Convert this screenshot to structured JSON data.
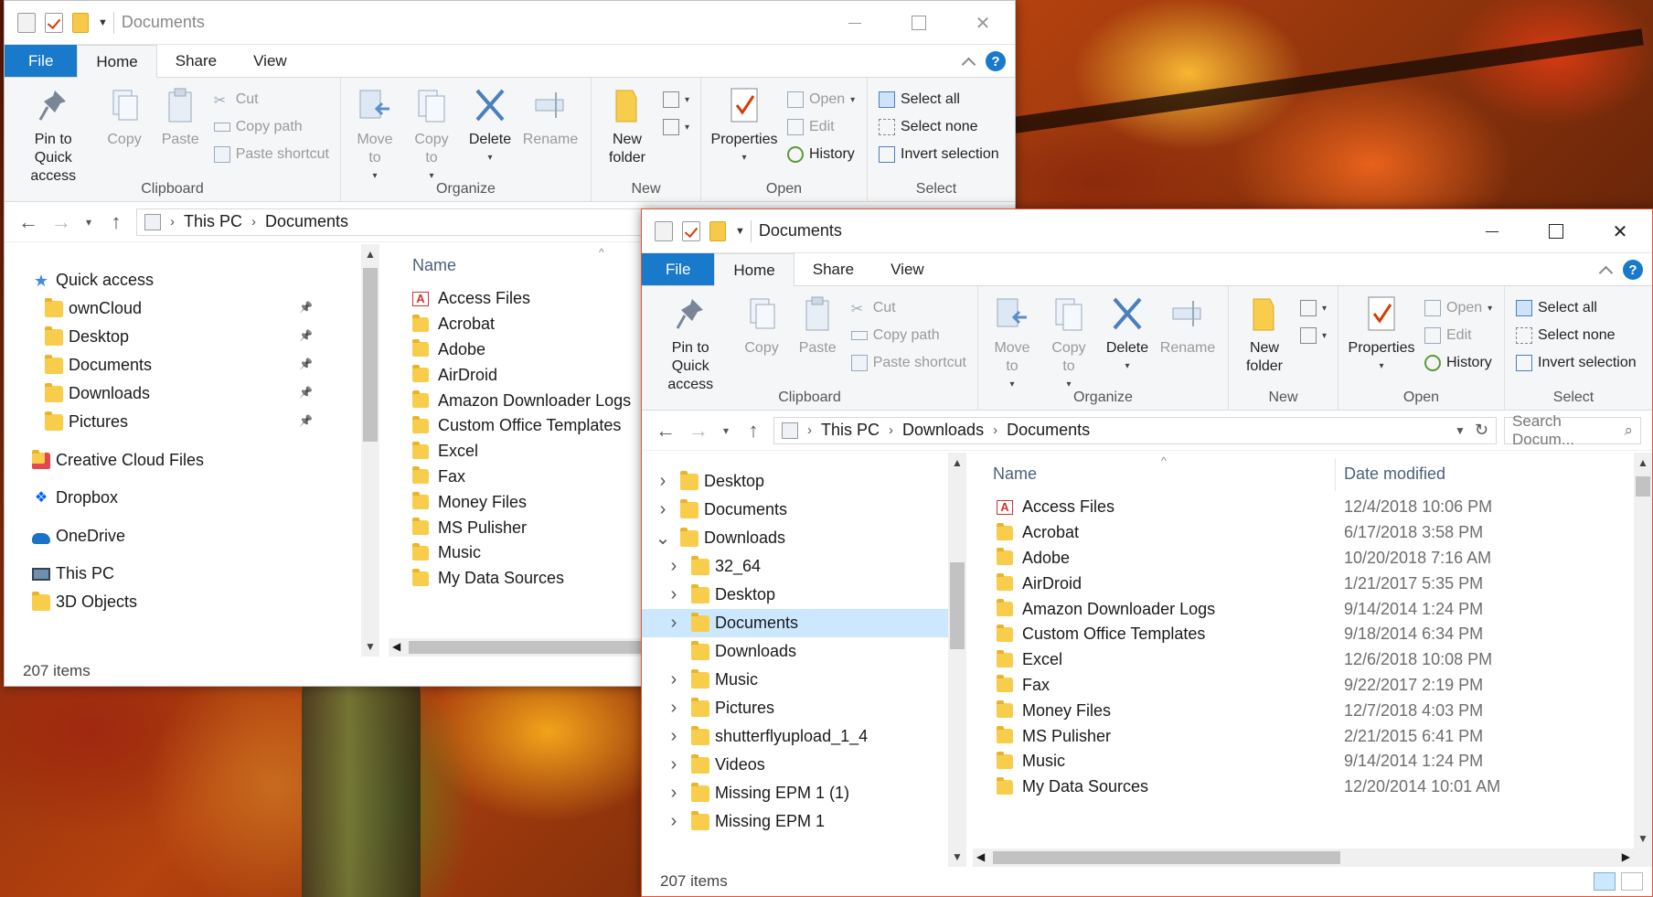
{
  "windows": [
    {
      "title": "Documents",
      "tabs": {
        "file": "File",
        "home": "Home",
        "share": "Share",
        "view": "View"
      },
      "ribbon": {
        "clipboard": {
          "label": "Clipboard",
          "pin": "Pin to Quick access",
          "copy": "Copy",
          "paste": "Paste",
          "cut": "Cut",
          "copy_path": "Copy path",
          "paste_shortcut": "Paste shortcut"
        },
        "organize": {
          "label": "Organize",
          "move_to": "Move to",
          "copy_to": "Copy to",
          "delete": "Delete",
          "rename": "Rename"
        },
        "new": {
          "label": "New",
          "new_folder": "New folder"
        },
        "open": {
          "label": "Open",
          "properties": "Properties",
          "open": "Open",
          "edit": "Edit",
          "history": "History"
        },
        "select": {
          "label": "Select",
          "select_all": "Select all",
          "select_none": "Select none",
          "invert": "Invert selection"
        }
      },
      "address": [
        "This PC",
        "Documents"
      ],
      "nav": [
        {
          "label": "Quick access",
          "icon": "star-icon"
        },
        {
          "label": "ownCloud",
          "icon": "folder-icon",
          "pinned": true
        },
        {
          "label": "Desktop",
          "icon": "desktop-folder-icon",
          "pinned": true
        },
        {
          "label": "Documents",
          "icon": "documents-folder-icon",
          "pinned": true
        },
        {
          "label": "Downloads",
          "icon": "downloads-folder-icon",
          "pinned": true
        },
        {
          "label": "Pictures",
          "icon": "pictures-folder-icon",
          "pinned": true
        },
        {
          "label": "Creative Cloud Files",
          "icon": "creative-cloud-icon"
        },
        {
          "label": "Dropbox",
          "icon": "dropbox-icon"
        },
        {
          "label": "OneDrive",
          "icon": "onedrive-icon"
        },
        {
          "label": "This PC",
          "icon": "computer-icon"
        },
        {
          "label": "3D Objects",
          "icon": "3d-objects-icon"
        }
      ],
      "column_name": "Name",
      "files": [
        "Access Files",
        "Acrobat",
        "Adobe",
        "AirDroid",
        "Amazon Downloader Logs",
        "Custom Office Templates",
        "Excel",
        "Fax",
        "Money Files",
        "MS Pulisher",
        "Music",
        "My Data Sources"
      ],
      "status": "207 items"
    },
    {
      "title": "Documents",
      "tabs": {
        "file": "File",
        "home": "Home",
        "share": "Share",
        "view": "View"
      },
      "ribbon": {
        "clipboard": {
          "label": "Clipboard",
          "pin": "Pin to Quick access",
          "copy": "Copy",
          "paste": "Paste",
          "cut": "Cut",
          "copy_path": "Copy path",
          "paste_shortcut": "Paste shortcut"
        },
        "organize": {
          "label": "Organize",
          "move_to": "Move to",
          "copy_to": "Copy to",
          "delete": "Delete",
          "rename": "Rename"
        },
        "new": {
          "label": "New",
          "new_folder": "New folder"
        },
        "open": {
          "label": "Open",
          "properties": "Properties",
          "open": "Open",
          "edit": "Edit",
          "history": "History"
        },
        "select": {
          "label": "Select",
          "select_all": "Select all",
          "select_none": "Select none",
          "invert": "Invert selection"
        }
      },
      "address": [
        "This PC",
        "Downloads",
        "Documents"
      ],
      "search_placeholder": "Search Docum...",
      "nav": [
        {
          "label": "Desktop",
          "level": 0,
          "expanded": false
        },
        {
          "label": "Documents",
          "level": 0,
          "expanded": false
        },
        {
          "label": "Downloads",
          "level": 0,
          "expanded": true
        },
        {
          "label": "32_64",
          "level": 1,
          "expanded": false
        },
        {
          "label": "Desktop",
          "level": 1,
          "expanded": false
        },
        {
          "label": "Documents",
          "level": 1,
          "expanded": false,
          "selected": true
        },
        {
          "label": "Downloads",
          "level": 1,
          "noexpand": true
        },
        {
          "label": "Music",
          "level": 1,
          "expanded": false
        },
        {
          "label": "Pictures",
          "level": 1,
          "expanded": false
        },
        {
          "label": "shutterflyupload_1_4",
          "level": 1,
          "expanded": false
        },
        {
          "label": "Videos",
          "level": 1,
          "expanded": false
        },
        {
          "label": "Missing EPM 1 (1)",
          "level": 1,
          "expanded": false
        },
        {
          "label": "Missing EPM 1",
          "level": 1,
          "expanded": false
        }
      ],
      "column_name": "Name",
      "column_date": "Date modified",
      "files": [
        {
          "name": "Access Files",
          "date": "12/4/2018 10:06 PM"
        },
        {
          "name": "Acrobat",
          "date": "6/17/2018 3:58 PM"
        },
        {
          "name": "Adobe",
          "date": "10/20/2018 7:16 AM"
        },
        {
          "name": "AirDroid",
          "date": "1/21/2017 5:35 PM"
        },
        {
          "name": "Amazon Downloader Logs",
          "date": "9/14/2014 1:24 PM"
        },
        {
          "name": "Custom Office Templates",
          "date": "9/18/2014 6:34 PM"
        },
        {
          "name": "Excel",
          "date": "12/6/2018 10:08 PM"
        },
        {
          "name": "Fax",
          "date": "9/22/2017 2:19 PM"
        },
        {
          "name": "Money Files",
          "date": "12/7/2018 4:03 PM"
        },
        {
          "name": "MS Pulisher",
          "date": "2/21/2015 6:41 PM"
        },
        {
          "name": "Music",
          "date": "9/14/2014 1:24 PM"
        },
        {
          "name": "My Data Sources",
          "date": "12/20/2014 10:01 AM"
        }
      ],
      "status": "207 items"
    }
  ]
}
